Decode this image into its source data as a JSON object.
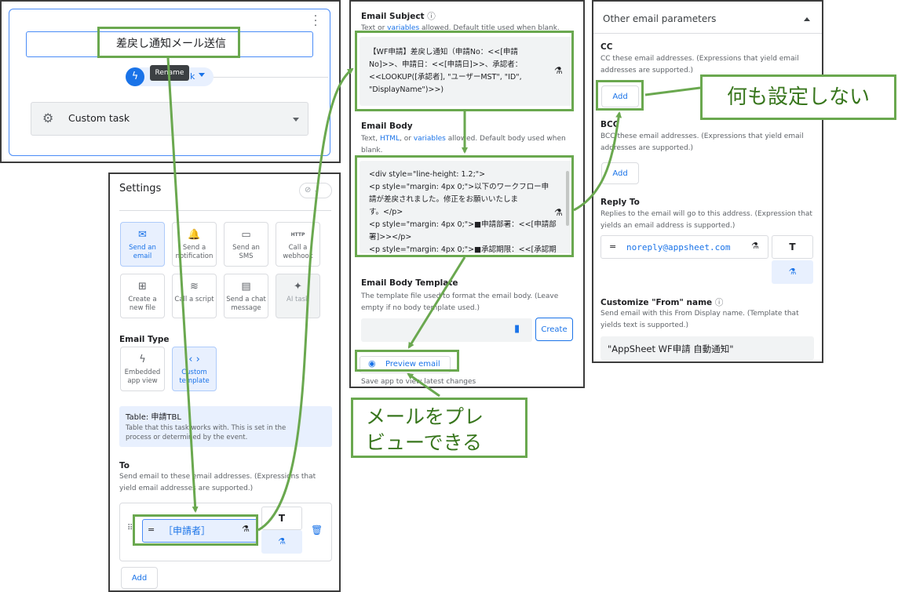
{
  "task_panel": {
    "rename_value": "差戻し通知メール送信",
    "tooltip": "Rename",
    "chip_suffix": "k",
    "task_type_label": "Custom task"
  },
  "settings": {
    "title": "Settings",
    "actions": [
      {
        "label": "Send an email",
        "icon": "mail-icon",
        "state": "selected"
      },
      {
        "label": "Send a notification",
        "icon": "bell-icon",
        "state": "normal"
      },
      {
        "label": "Send an SMS",
        "icon": "sms-icon",
        "state": "normal"
      },
      {
        "label": "Call a webhook",
        "icon": "http-icon",
        "state": "normal"
      },
      {
        "label": "Create a new file",
        "icon": "new-file-icon",
        "state": "normal"
      },
      {
        "label": "Call a script",
        "icon": "script-icon",
        "state": "normal"
      },
      {
        "label": "Send a chat message",
        "icon": "chat-icon",
        "state": "normal"
      },
      {
        "label": "AI task",
        "icon": "sparkle-icon",
        "state": "disabled"
      }
    ],
    "email_type_label": "Email Type",
    "email_types": [
      {
        "label": "Embedded app view",
        "icon": "bolt-icon",
        "state": "normal"
      },
      {
        "label": "Custom template",
        "icon": "code-icon",
        "state": "selected"
      }
    ],
    "table_label": "Table:",
    "table_name": "申請TBL",
    "table_desc": "Table that this task works with. This is set in the process or determined by the event.",
    "to_label": "To",
    "to_desc": "Send email to these email addresses. (Expressions that yield email addresses are supported.)",
    "to_eq": "=",
    "to_value": "［申請者］",
    "add_label": "Add"
  },
  "email": {
    "subject_label": "Email Subject",
    "subject_desc_pre": "Text or",
    "subject_desc_link": "variables",
    "subject_desc_post": "allowed. Default title used when blank.",
    "subject_value": "【WF申請】差戻し通知（申請No：<<[申請No]>>、申請日：<<[申請日]>>、承認者：<<LOOKUP([承認者], \"ユーザーMST\", \"ID\", \"DisplayName\")>>)",
    "body_label": "Email Body",
    "body_desc_pre": "Text,",
    "body_desc_link1": "HTML",
    "body_desc_mid": ", or",
    "body_desc_link2": "variables",
    "body_desc_post": "allowed. Default body used when blank.",
    "body_lines": [
      "<div style=\"line-height: 1.2;\">",
      "<p style=\"margin: 4px 0;\">以下のワークフロー申",
      "請が差戻されました。修正をお願いいたしま",
      "す。</p>",
      "<p style=\"margin: 4px 0;\">■申請部署：<<[申請部",
      "署]>></p>",
      "<p style=\"margin: 4px 0;\">■承認期限：<<[承認期"
    ],
    "template_label": "Email Body Template",
    "template_desc": "The template file used to format the email body. (Leave empty if no body template used.)",
    "create_label": "Create",
    "preview_label": "Preview email",
    "save_hint": "Save app to view latest changes"
  },
  "other": {
    "title": "Other email parameters",
    "cc_label": "CC",
    "cc_desc": "CC these email addresses. (Expressions that yield email addresses are supported.)",
    "bcc_label": "BCC",
    "bcc_desc": "BCC these email addresses. (Expressions that yield email addresses are supported.)",
    "add_label": "Add",
    "reply_label": "Reply To",
    "reply_desc": "Replies to the email will go to this address. (Expression that yields an email address is supported.)",
    "reply_eq": "=",
    "reply_value": "noreply@appsheet.com",
    "from_label": "Customize \"From\" name",
    "from_desc": "Send email with this From Display name. (Template that yields text is supported.)",
    "from_value": "\"AppSheet WF申請 自動通知\""
  },
  "callouts": {
    "no_setting": "何も設定しない",
    "preview_line1": "メールをプレ",
    "preview_line2": "ビューできる"
  },
  "colors": {
    "annotation_green": "#6aa84f",
    "annotation_text": "#38761d",
    "accent_blue": "#1a73e8",
    "selected_bg": "#e8f0fe"
  }
}
